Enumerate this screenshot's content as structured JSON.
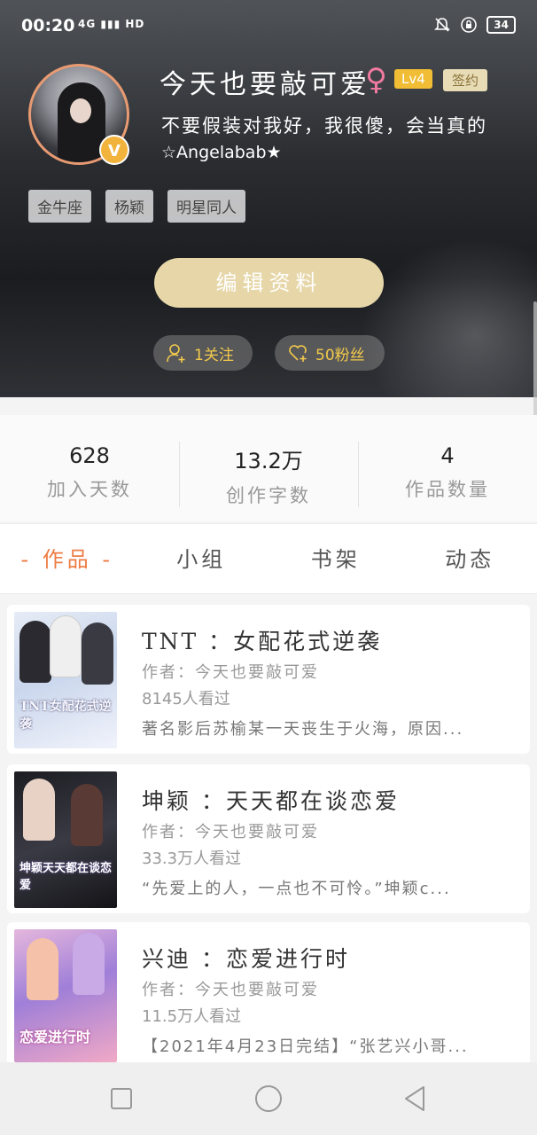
{
  "status_bar": {
    "time": "00:20",
    "network": "4G",
    "network_sub": "HD",
    "battery": "34"
  },
  "profile": {
    "username": "今天也要敲可爱",
    "gender_symbol": "♀",
    "level": "Lv4",
    "signed_badge": "签约",
    "bio": "不要假装对我好，我很傻，会当真的",
    "bio_line2": "☆Angelabab★",
    "verified_badge": "V",
    "tags": [
      "金牛座",
      "杨颖",
      "明星同人"
    ],
    "edit_button": "编辑资料",
    "follow_label": "1关注",
    "fans_label": "50粉丝"
  },
  "stats": [
    {
      "value": "628",
      "label": "加入天数"
    },
    {
      "value": "13.2万",
      "label": "创作字数"
    },
    {
      "value": "4",
      "label": "作品数量"
    }
  ],
  "tabs": [
    "- 作品 -",
    "小组",
    "书架",
    "动态"
  ],
  "works": [
    {
      "title": "TNT ：女配花式逆袭",
      "author": "作者：今天也要敲可爱",
      "views": "8145人看过",
      "desc": "著名影后苏榆某一天丧生于火海，原因...",
      "cover_text": "TNT女配花式逆袭"
    },
    {
      "title": "坤颖 ：天天都在谈恋爱",
      "author": "作者：今天也要敲可爱",
      "views": "33.3万人看过",
      "desc": "“先爱上的人，一点也不可怜。”坤颖c...",
      "cover_text": "坤颖天天都在谈恋爱"
    },
    {
      "title": "兴迪 ：恋爱进行时",
      "author": "作者：今天也要敲可爱",
      "views": "11.5万人看过",
      "desc": "【2021年4月23日完结】“张艺兴小哥...",
      "cover_text": "恋爱进行时"
    }
  ],
  "colors": {
    "accent_orange": "#ee7c43",
    "gold": "#e6d6a8",
    "level_badge": "#f1bd35",
    "pill_text": "#f2c94c"
  }
}
